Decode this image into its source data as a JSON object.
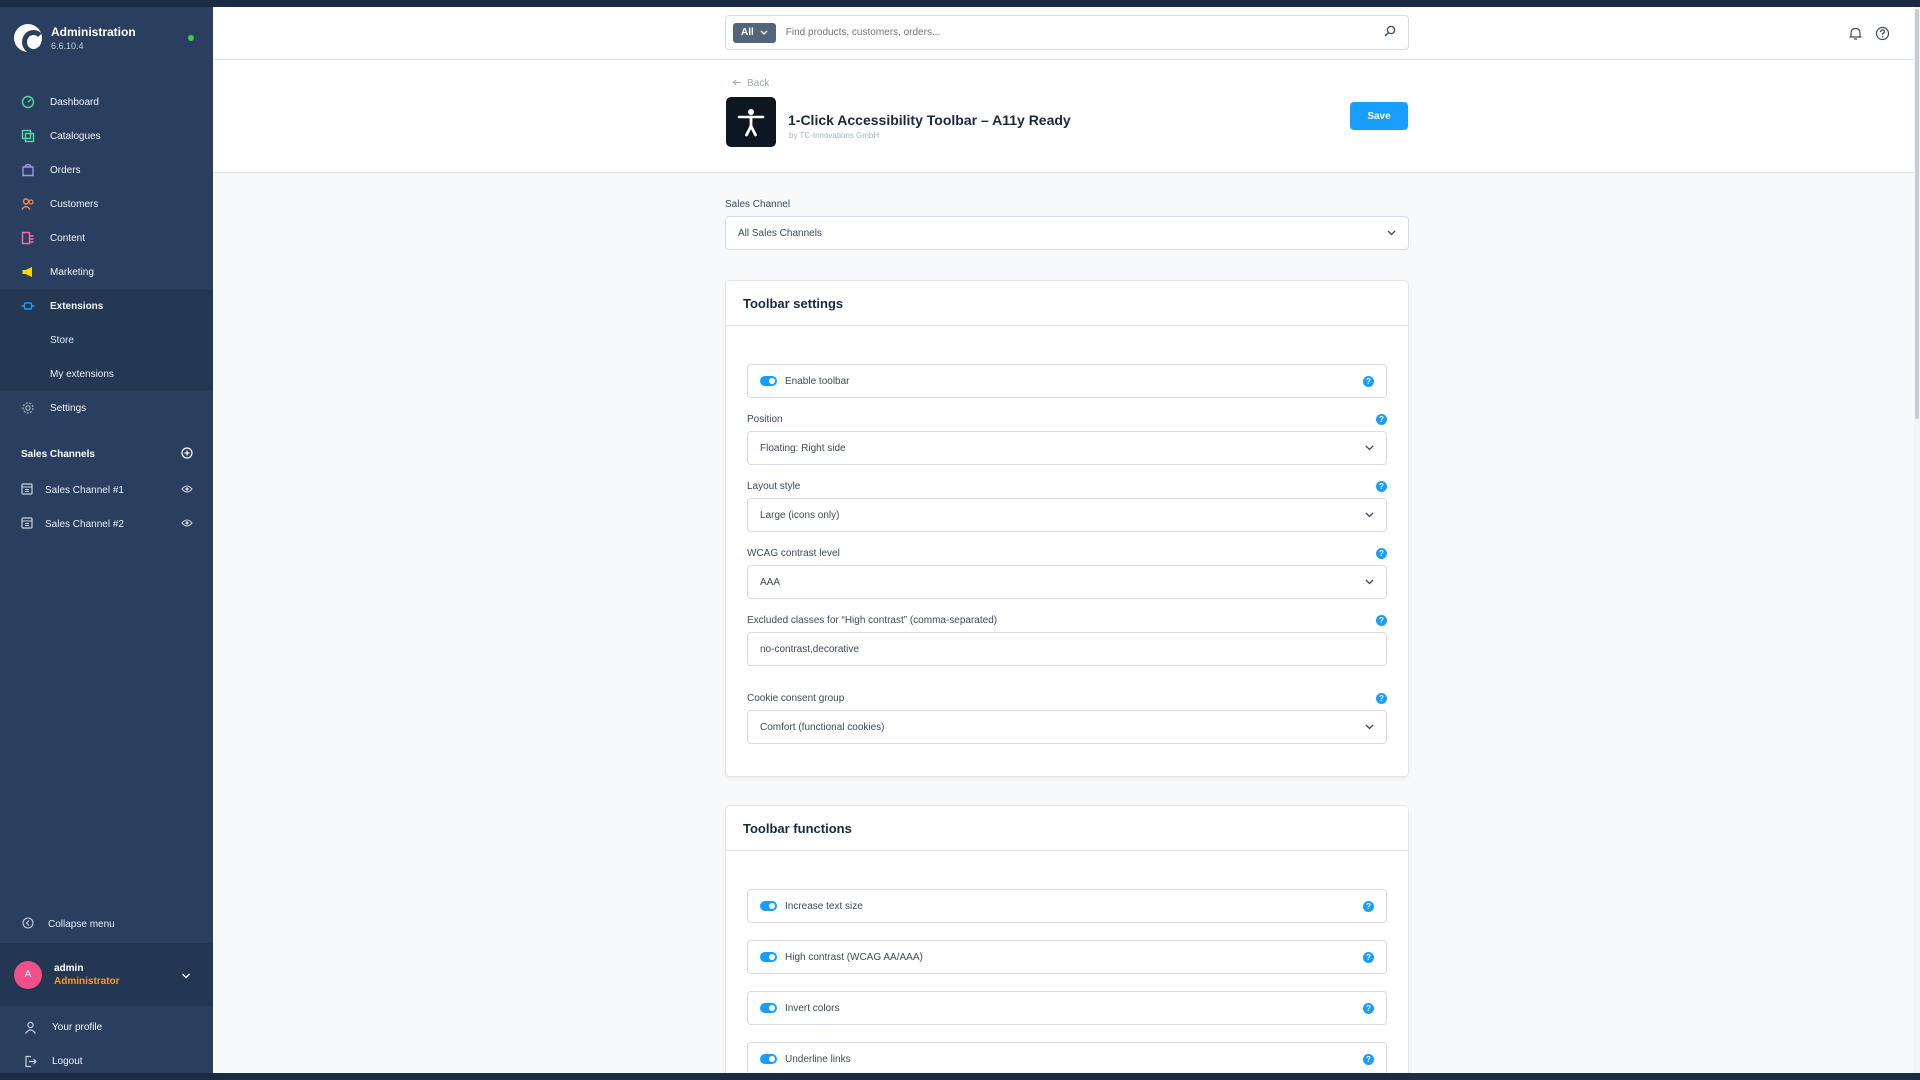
{
  "app": {
    "title": "Administration",
    "version": "6.6.10.4"
  },
  "sidebar": {
    "items": [
      {
        "label": "Dashboard",
        "icon": "dashboard-icon",
        "color": "#57d9a3"
      },
      {
        "label": "Catalogues",
        "icon": "catalogues-icon",
        "color": "#57d9a3"
      },
      {
        "label": "Orders",
        "icon": "orders-icon",
        "color": "#a092f0"
      },
      {
        "label": "Customers",
        "icon": "customers-icon",
        "color": "#f88962"
      },
      {
        "label": "Content",
        "icon": "content-icon",
        "color": "#ff68b4"
      },
      {
        "label": "Marketing",
        "icon": "marketing-icon",
        "color": "#ffd700"
      },
      {
        "label": "Extensions",
        "icon": "extensions-icon",
        "color": "#189eff"
      },
      {
        "label": "Store"
      },
      {
        "label": "My extensions"
      },
      {
        "label": "Settings",
        "icon": "settings-icon",
        "color": "#9aa8b5"
      }
    ],
    "sales_channels_title": "Sales Channels",
    "sales_channels": [
      {
        "label": "Sales Channel #1"
      },
      {
        "label": "Sales Channel #2"
      }
    ],
    "collapse_label": "Collapse menu",
    "user": {
      "initial": "A",
      "name": "admin",
      "role": "Administrator"
    },
    "bottom": [
      {
        "label": "Your profile"
      },
      {
        "label": "Logout"
      }
    ]
  },
  "search": {
    "type_label": "All",
    "placeholder": "Find products, customers, orders..."
  },
  "header": {
    "back_label": "Back",
    "plugin_title": "1-Click Accessibility Toolbar – A11y Ready",
    "plugin_vendor": "by TC-Innovations GmbH",
    "save_label": "Save"
  },
  "sales_channel_field": {
    "label": "Sales Channel",
    "value": "All Sales Channels"
  },
  "toolbar_settings": {
    "title": "Toolbar settings",
    "enable_label": "Enable toolbar",
    "position_label": "Position",
    "position_value": "Floating: Right side",
    "layout_label": "Layout style",
    "layout_value": "Large (icons only)",
    "wcag_label": "WCAG contrast level",
    "wcag_value": "AAA",
    "excluded_label": "Excluded classes for “High contrast” (comma-separated)",
    "excluded_value": "no-contrast,decorative",
    "cookie_label": "Cookie consent group",
    "cookie_value": "Comfort (functional cookies)"
  },
  "toolbar_functions": {
    "title": "Toolbar functions",
    "items": [
      {
        "label": "Increase text size"
      },
      {
        "label": "High contrast (WCAG AA/AAA)"
      },
      {
        "label": "Invert colors"
      },
      {
        "label": "Underline links"
      }
    ]
  },
  "colors": {
    "sidebar_bg": "#2a3f5f",
    "accent": "#189eff",
    "role": "#ff9a1e"
  }
}
